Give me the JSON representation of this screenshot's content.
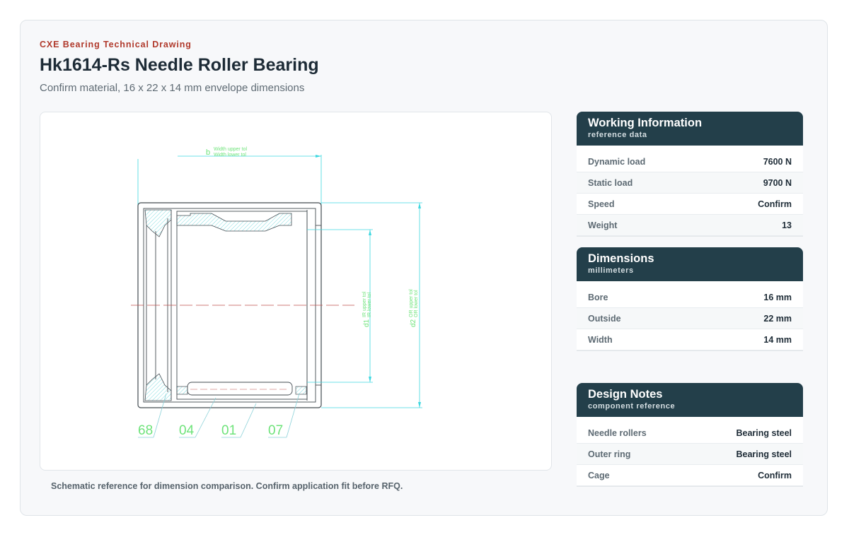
{
  "header": {
    "eyebrow": "CXE Bearing Technical Drawing",
    "title": "Hk1614-Rs Needle Roller Bearing",
    "subtitle": "Confirm material, 16 x 22 x 14 mm envelope dimensions"
  },
  "drawing": {
    "width_label_main": "b",
    "width_label_upper": "Width upper tol",
    "width_label_lower": "Width lower tol",
    "d1_label_main": "d1",
    "d1_label_upper": "IR upper tol",
    "d1_label_lower": "IR lower tol",
    "d2_label_main": "d2",
    "d2_label_upper": "OR upper tol",
    "d2_label_lower": "OR lower tol",
    "callouts": [
      "68",
      "04",
      "01",
      "07"
    ],
    "colors": {
      "dimension": "#3fd8e0",
      "callout": "#6ee37a",
      "outline": "#444c52",
      "hatch": "#5fd3d8",
      "centerline": "#c0504d"
    }
  },
  "caption": "Schematic reference for dimension comparison. Confirm application fit before RFQ.",
  "panels": {
    "working": {
      "title": "Working Information",
      "subtitle": "reference data",
      "rows": [
        {
          "label": "Dynamic load",
          "value": "7600 N"
        },
        {
          "label": "Static load",
          "value": "9700 N"
        },
        {
          "label": "Speed",
          "value": "Confirm"
        },
        {
          "label": "Weight",
          "value": "13"
        }
      ]
    },
    "dimensions": {
      "title": "Dimensions",
      "subtitle": "millimeters",
      "rows": [
        {
          "label": "Bore",
          "value": "16 mm"
        },
        {
          "label": "Outside",
          "value": "22 mm"
        },
        {
          "label": "Width",
          "value": "14 mm"
        }
      ]
    },
    "design": {
      "title": "Design Notes",
      "subtitle": "component reference",
      "rows": [
        {
          "label": "Needle rollers",
          "value": "Bearing steel"
        },
        {
          "label": "Outer ring",
          "value": "Bearing steel"
        },
        {
          "label": "Cage",
          "value": "Confirm"
        }
      ]
    }
  }
}
